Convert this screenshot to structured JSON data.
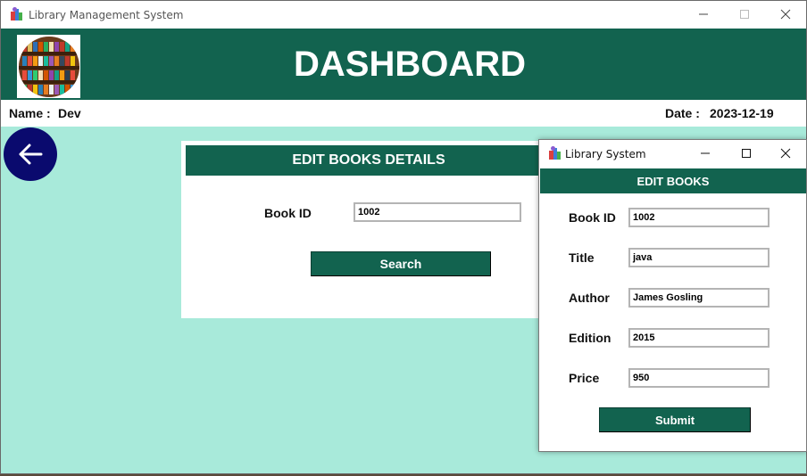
{
  "main_window": {
    "title": "Library Management System",
    "controls": {
      "minimize": "—",
      "maximize": "☐",
      "close": "✕"
    }
  },
  "header": {
    "title": "DASHBOARD",
    "logo_icon": "bookshelf-logo"
  },
  "user_info": {
    "name_label": "Name :",
    "name_value": "Dev",
    "date_label": "Date :",
    "date_value": "2023-12-19"
  },
  "back_button": {
    "icon": "arrow-left-icon"
  },
  "edit_panel": {
    "heading": "EDIT BOOKS DETAILS",
    "book_id_label": "Book ID",
    "book_id_value": "1002",
    "search_label": "Search"
  },
  "popup": {
    "title": "Library System",
    "heading": "EDIT BOOKS",
    "fields": [
      {
        "label": "Book ID",
        "value": "1002"
      },
      {
        "label": "Title",
        "value": "java"
      },
      {
        "label": "Author",
        "value": "James Gosling"
      },
      {
        "label": "Edition",
        "value": "2015"
      },
      {
        "label": "Price",
        "value": "950"
      }
    ],
    "submit_label": "Submit"
  },
  "colors": {
    "header_bg": "#12634f",
    "body_bg": "#a8eada",
    "back_button_bg": "#0a0a6e",
    "text_on_header": "#ffffff"
  }
}
